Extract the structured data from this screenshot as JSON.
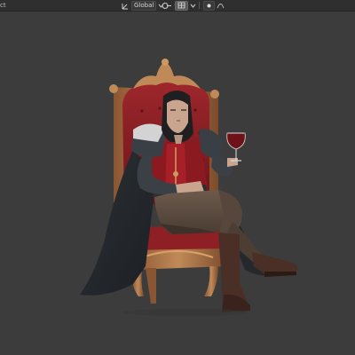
{
  "header": {
    "left_label": "ct",
    "orientation": "Global",
    "icons": [
      "transform-orientation-icon",
      "chevron-down-icon",
      "pivot-icon",
      "snap-icon",
      "proportional-edit-icon",
      "falloff-icon"
    ]
  },
  "colors": {
    "viewport_bg": "#3c3c3c",
    "header_bg": "#2f2f2f",
    "throne_red": "#8b1e24",
    "gold": "#b07a45",
    "wine": "#5a0d14"
  }
}
